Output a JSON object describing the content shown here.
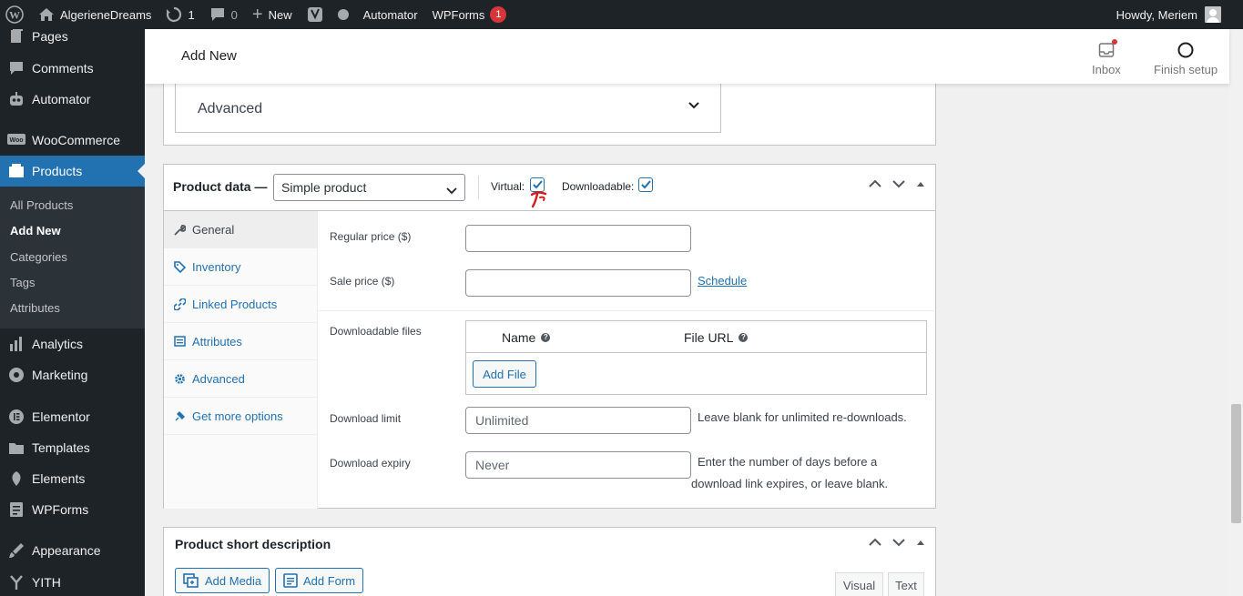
{
  "admin_bar": {
    "site_name": "AlgerieneDreams",
    "updates_count": "1",
    "comments_count": "0",
    "new_label": "New",
    "automator_label": "Automator",
    "wpforms_label": "WPForms",
    "wpforms_badge": "1",
    "howdy": "Howdy, Meriem"
  },
  "sidebar": {
    "items": [
      {
        "label": "Pages",
        "icon": "pages-icon"
      },
      {
        "label": "Comments",
        "icon": "comments-icon"
      },
      {
        "label": "Automator",
        "icon": "automator-icon"
      },
      {
        "label": "WooCommerce",
        "icon": "woocommerce-icon"
      },
      {
        "label": "Products",
        "icon": "products-icon"
      },
      {
        "label": "Analytics",
        "icon": "analytics-icon"
      },
      {
        "label": "Marketing",
        "icon": "marketing-icon"
      },
      {
        "label": "Elementor",
        "icon": "elementor-icon"
      },
      {
        "label": "Templates",
        "icon": "templates-icon"
      },
      {
        "label": "Elements",
        "icon": "elements-icon"
      },
      {
        "label": "WPForms",
        "icon": "wpforms-icon"
      },
      {
        "label": "Appearance",
        "icon": "appearance-icon"
      },
      {
        "label": "YITH",
        "icon": "yith-icon"
      }
    ],
    "submenu": [
      "All Products",
      "Add New",
      "Categories",
      "Tags",
      "Attributes"
    ]
  },
  "header": {
    "title": "Add New",
    "inbox_label": "Inbox",
    "finish_setup_label": "Finish setup"
  },
  "advanced_panel": {
    "label": "Advanced"
  },
  "product_data": {
    "title": "Product data —",
    "type_selected": "Simple product",
    "virtual_label": "Virtual:",
    "virtual_checked": true,
    "downloadable_label": "Downloadable:",
    "downloadable_checked": true,
    "tabs": [
      {
        "label": "General",
        "icon": "wrench-icon"
      },
      {
        "label": "Inventory",
        "icon": "tag-icon"
      },
      {
        "label": "Linked Products",
        "icon": "link-icon"
      },
      {
        "label": "Attributes",
        "icon": "list-icon"
      },
      {
        "label": "Advanced",
        "icon": "gear-icon"
      },
      {
        "label": "Get more options",
        "icon": "plugin-icon"
      }
    ],
    "regular_price_label": "Regular price ($)",
    "regular_price_value": "",
    "sale_price_label": "Sale price ($)",
    "sale_price_value": "",
    "schedule_link": "Schedule",
    "downloadable_files_label": "Downloadable files",
    "col_name": "Name",
    "col_file_url": "File URL",
    "add_file_button": "Add File",
    "download_limit_label": "Download limit",
    "download_limit_placeholder": "Unlimited",
    "download_limit_hint": "Leave blank for unlimited re-downloads.",
    "download_expiry_label": "Download expiry",
    "download_expiry_placeholder": "Never",
    "download_expiry_hint_1": "Enter the number of days before a",
    "download_expiry_hint_2": "download link expires, or leave blank."
  },
  "short_description": {
    "title": "Product short description",
    "add_media": "Add Media",
    "add_form": "Add Form",
    "tab_visual": "Visual",
    "tab_text": "Text"
  },
  "colors": {
    "accent": "#2271b1",
    "admin_dark": "#1d2327",
    "badge_red": "#d63638"
  }
}
